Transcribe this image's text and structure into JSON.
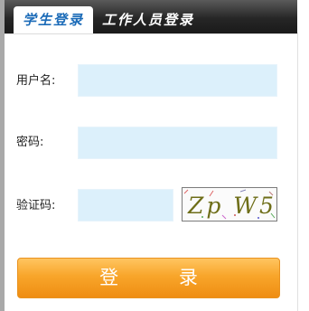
{
  "tabs": {
    "student_label": "学生登录",
    "staff_label": "工作人员登录"
  },
  "form": {
    "username_label": "用户名:",
    "username_value": "",
    "password_label": "密码:",
    "password_value": "",
    "captcha_label": "验证码:",
    "captcha_value": "",
    "captcha_image_text": "Zp W5"
  },
  "login_button_label": "登 录",
  "colors": {
    "input_bg": "#dcf0fb",
    "active_tab_text": "#1b6bb8",
    "button_orange": "#f8a52a"
  }
}
